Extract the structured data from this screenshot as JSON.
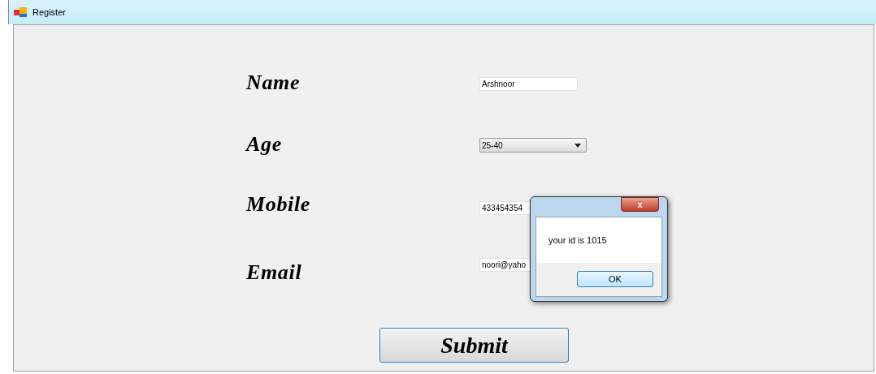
{
  "window": {
    "title": "Register"
  },
  "form": {
    "fields": [
      {
        "label": "Name",
        "kind": "text",
        "value": "Arshnoor"
      },
      {
        "label": "Age",
        "kind": "dropdown",
        "value": "25-40"
      },
      {
        "label": "Mobile",
        "kind": "text",
        "value": "433454354"
      },
      {
        "label": "Email",
        "kind": "text",
        "value": "noori@yaho"
      }
    ],
    "submit": "Submit"
  },
  "dialog": {
    "close": "x",
    "message": "your id is 1015",
    "ok": "OK"
  }
}
